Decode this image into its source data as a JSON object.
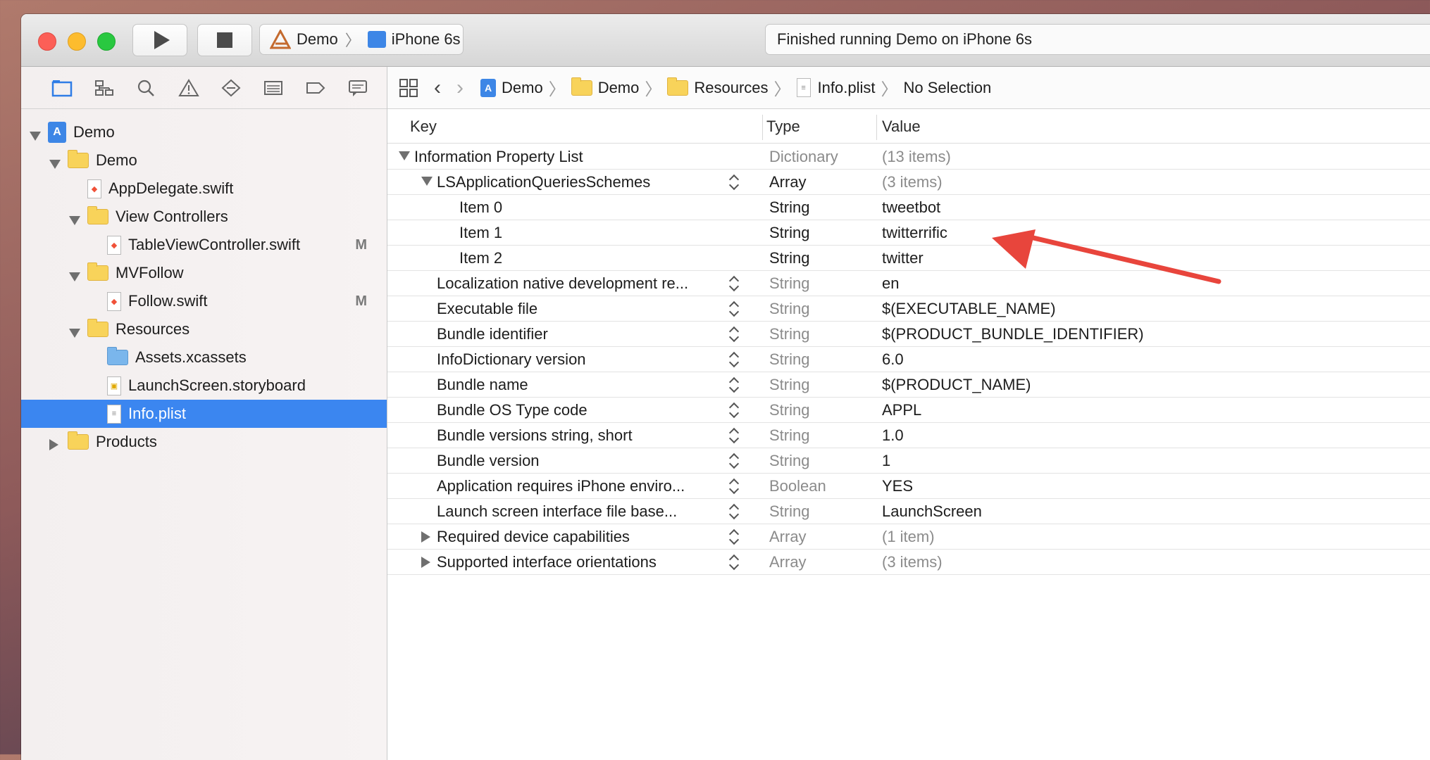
{
  "toolbar": {
    "scheme_project": "Demo",
    "scheme_device": "iPhone 6s",
    "status_text": "Finished running Demo on iPhone 6s"
  },
  "navigator": {
    "tabs": [
      "folder-icon",
      "hierarchy-icon",
      "search-icon",
      "warning-icon",
      "test-diamond-icon",
      "list-icon",
      "breakpoint-icon",
      "message-icon"
    ],
    "tree": [
      {
        "label": "Demo",
        "indent": 0,
        "icon": "project",
        "disclosure": "open",
        "badge": ""
      },
      {
        "label": "Demo",
        "indent": 1,
        "icon": "folder",
        "disclosure": "open",
        "badge": ""
      },
      {
        "label": "AppDelegate.swift",
        "indent": 2,
        "icon": "swift",
        "disclosure": "",
        "badge": ""
      },
      {
        "label": "View Controllers",
        "indent": 2,
        "icon": "folder",
        "disclosure": "open",
        "badge": ""
      },
      {
        "label": "TableViewController.swift",
        "indent": 3,
        "icon": "swift",
        "disclosure": "",
        "badge": "M"
      },
      {
        "label": "MVFollow",
        "indent": 2,
        "icon": "folder",
        "disclosure": "open",
        "badge": ""
      },
      {
        "label": "Follow.swift",
        "indent": 3,
        "icon": "swift",
        "disclosure": "",
        "badge": "M"
      },
      {
        "label": "Resources",
        "indent": 2,
        "icon": "folder",
        "disclosure": "open",
        "badge": ""
      },
      {
        "label": "Assets.xcassets",
        "indent": 3,
        "icon": "assets",
        "disclosure": "",
        "badge": ""
      },
      {
        "label": "LaunchScreen.storyboard",
        "indent": 3,
        "icon": "storyboard",
        "disclosure": "",
        "badge": ""
      },
      {
        "label": "Info.plist",
        "indent": 3,
        "icon": "plist",
        "disclosure": "",
        "badge": "",
        "selected": true
      },
      {
        "label": "Products",
        "indent": 1,
        "icon": "folder",
        "disclosure": "closed",
        "badge": ""
      }
    ]
  },
  "jumpbar": {
    "items": [
      "Demo",
      "Demo",
      "Resources",
      "Info.plist",
      "No Selection"
    ]
  },
  "columns": {
    "key": "Key",
    "type": "Type",
    "value": "Value"
  },
  "plist": [
    {
      "key": "Information Property List",
      "type": "Dictionary",
      "value": "(13 items)",
      "level": 0,
      "disclosure": "open",
      "muted_type": true,
      "muted_value": true,
      "stepper": false
    },
    {
      "key": "LSApplicationQueriesSchemes",
      "type": "Array",
      "value": "(3 items)",
      "level": 1,
      "disclosure": "open",
      "muted_type": false,
      "muted_value": true,
      "stepper": true
    },
    {
      "key": "Item 0",
      "type": "String",
      "value": "tweetbot",
      "level": 2,
      "disclosure": "",
      "muted_type": false,
      "muted_value": false,
      "stepper": false
    },
    {
      "key": "Item 1",
      "type": "String",
      "value": "twitterrific",
      "level": 2,
      "disclosure": "",
      "muted_type": false,
      "muted_value": false,
      "stepper": false
    },
    {
      "key": "Item 2",
      "type": "String",
      "value": "twitter",
      "level": 2,
      "disclosure": "",
      "muted_type": false,
      "muted_value": false,
      "stepper": false
    },
    {
      "key": "Localization native development re...",
      "type": "String",
      "value": "en",
      "level": 1,
      "disclosure": "",
      "muted_type": true,
      "muted_value": false,
      "stepper": true
    },
    {
      "key": "Executable file",
      "type": "String",
      "value": "$(EXECUTABLE_NAME)",
      "level": 1,
      "disclosure": "",
      "muted_type": true,
      "muted_value": false,
      "stepper": true
    },
    {
      "key": "Bundle identifier",
      "type": "String",
      "value": "$(PRODUCT_BUNDLE_IDENTIFIER)",
      "level": 1,
      "disclosure": "",
      "muted_type": true,
      "muted_value": false,
      "stepper": true
    },
    {
      "key": "InfoDictionary version",
      "type": "String",
      "value": "6.0",
      "level": 1,
      "disclosure": "",
      "muted_type": true,
      "muted_value": false,
      "stepper": true
    },
    {
      "key": "Bundle name",
      "type": "String",
      "value": "$(PRODUCT_NAME)",
      "level": 1,
      "disclosure": "",
      "muted_type": true,
      "muted_value": false,
      "stepper": true
    },
    {
      "key": "Bundle OS Type code",
      "type": "String",
      "value": "APPL",
      "level": 1,
      "disclosure": "",
      "muted_type": true,
      "muted_value": false,
      "stepper": true
    },
    {
      "key": "Bundle versions string, short",
      "type": "String",
      "value": "1.0",
      "level": 1,
      "disclosure": "",
      "muted_type": true,
      "muted_value": false,
      "stepper": true
    },
    {
      "key": "Bundle version",
      "type": "String",
      "value": "1",
      "level": 1,
      "disclosure": "",
      "muted_type": true,
      "muted_value": false,
      "stepper": true
    },
    {
      "key": "Application requires iPhone enviro...",
      "type": "Boolean",
      "value": "YES",
      "level": 1,
      "disclosure": "",
      "muted_type": true,
      "muted_value": false,
      "stepper": true
    },
    {
      "key": "Launch screen interface file base...",
      "type": "String",
      "value": "LaunchScreen",
      "level": 1,
      "disclosure": "",
      "muted_type": true,
      "muted_value": false,
      "stepper": true
    },
    {
      "key": "Required device capabilities",
      "type": "Array",
      "value": "(1 item)",
      "level": 1,
      "disclosure": "closed",
      "muted_type": true,
      "muted_value": true,
      "stepper": true
    },
    {
      "key": "Supported interface orientations",
      "type": "Array",
      "value": "(3 items)",
      "level": 1,
      "disclosure": "closed",
      "muted_type": true,
      "muted_value": true,
      "stepper": true
    }
  ],
  "colors": {
    "selection": "#3b86f0",
    "annotation_arrow": "#e8453c"
  }
}
